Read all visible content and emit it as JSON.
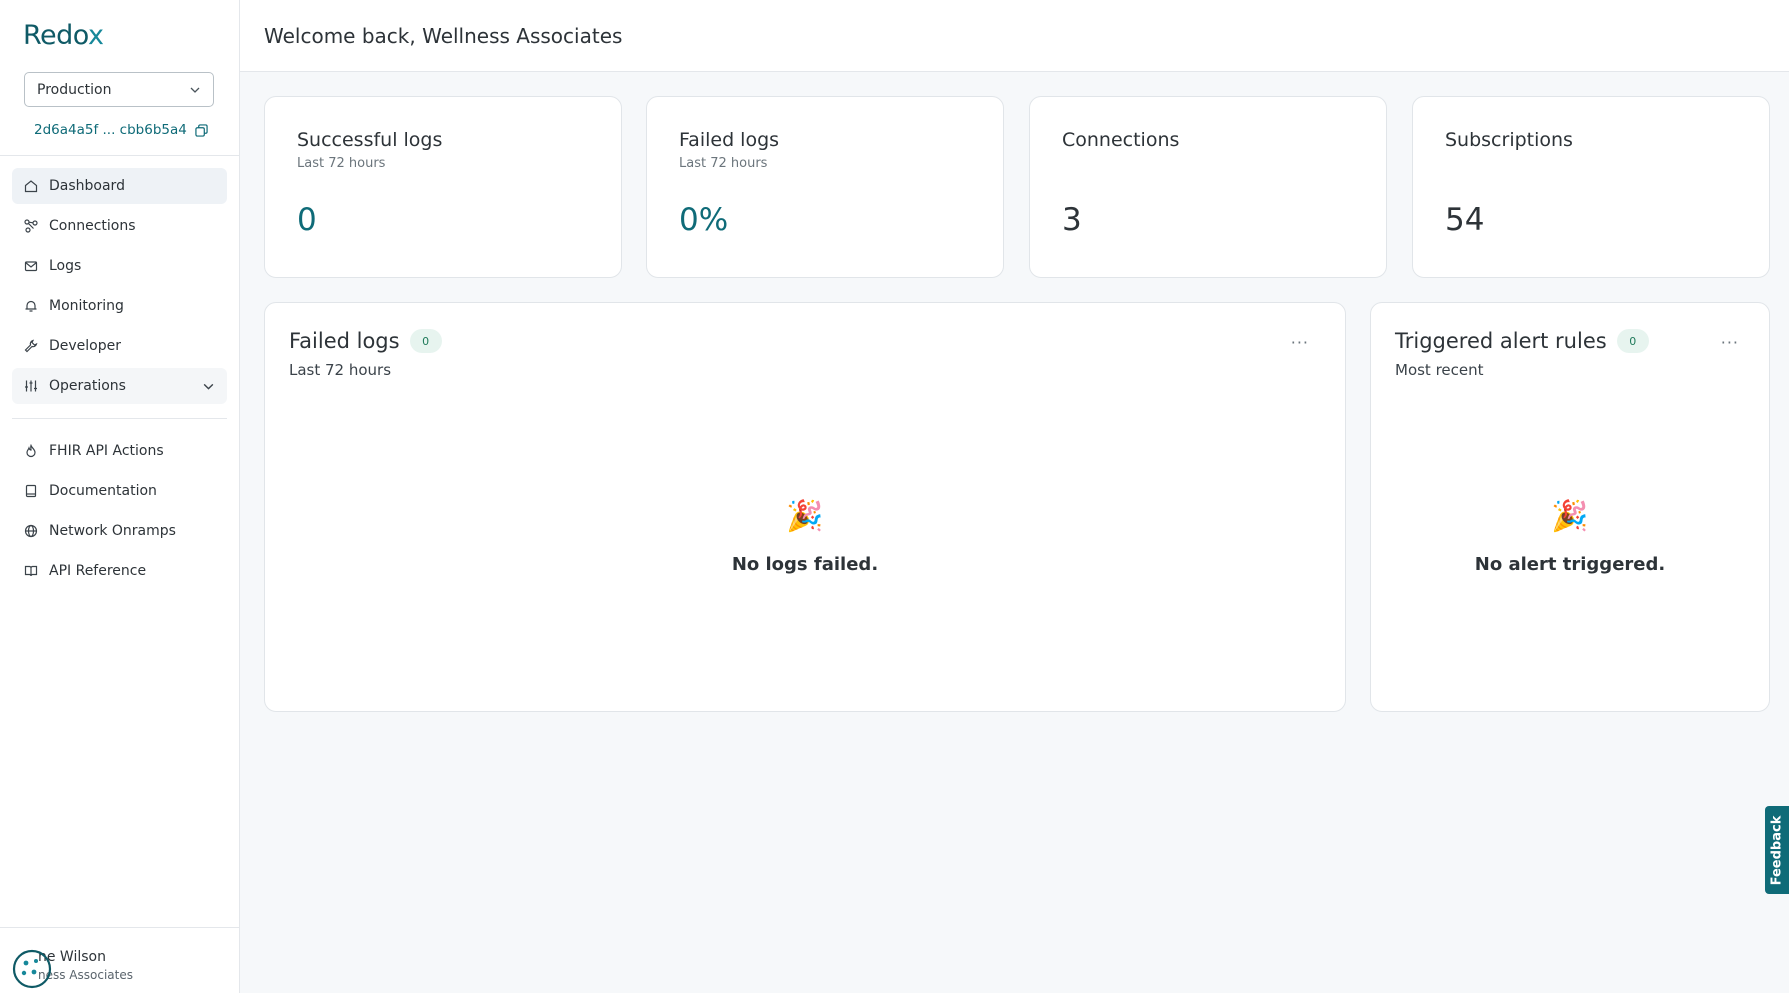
{
  "brand": {
    "logo_prefix": "Redo",
    "logo_suffix": "x"
  },
  "environment": {
    "selected": "Production"
  },
  "org": {
    "id": "2d6a4a5f ... cbb6b5a4"
  },
  "nav": {
    "primary": [
      {
        "label": "Dashboard",
        "icon": "home-icon"
      },
      {
        "label": "Connections",
        "icon": "connections-icon"
      },
      {
        "label": "Logs",
        "icon": "mail-icon"
      },
      {
        "label": "Monitoring",
        "icon": "bell-icon"
      },
      {
        "label": "Developer",
        "icon": "wrench-icon"
      },
      {
        "label": "Operations",
        "icon": "sliders-icon"
      }
    ],
    "secondary": [
      {
        "label": "FHIR API Actions",
        "icon": "flame-icon"
      },
      {
        "label": "Documentation",
        "icon": "book-icon"
      },
      {
        "label": "Network Onramps",
        "icon": "globe-icon"
      },
      {
        "label": "API Reference",
        "icon": "open-book-icon"
      }
    ]
  },
  "user": {
    "name": "ne Wilson",
    "org": "ness Associates"
  },
  "header": {
    "title": "Welcome back, Wellness Associates"
  },
  "stats": [
    {
      "title": "Successful logs",
      "subtitle": "Last 72 hours",
      "value": "0"
    },
    {
      "title": "Failed logs",
      "subtitle": "Last 72 hours",
      "value": "0%"
    },
    {
      "title": "Connections",
      "subtitle": "",
      "value": "3"
    },
    {
      "title": "Subscriptions",
      "subtitle": "",
      "value": "54"
    }
  ],
  "panels": {
    "failed_logs": {
      "title": "Failed logs",
      "count": "0",
      "subtitle": "Last 72 hours",
      "empty_text": "No logs failed.",
      "more": "···"
    },
    "alerts": {
      "title": "Triggered alert rules",
      "count": "0",
      "subtitle": "Most recent",
      "empty_text": "No alert triggered.",
      "more": "···"
    }
  },
  "feedback": {
    "label": "Feedback"
  },
  "colors": {
    "accent": "#0f6b78",
    "badge_bg": "#e7f4ef",
    "badge_text": "#1f7a5a"
  }
}
